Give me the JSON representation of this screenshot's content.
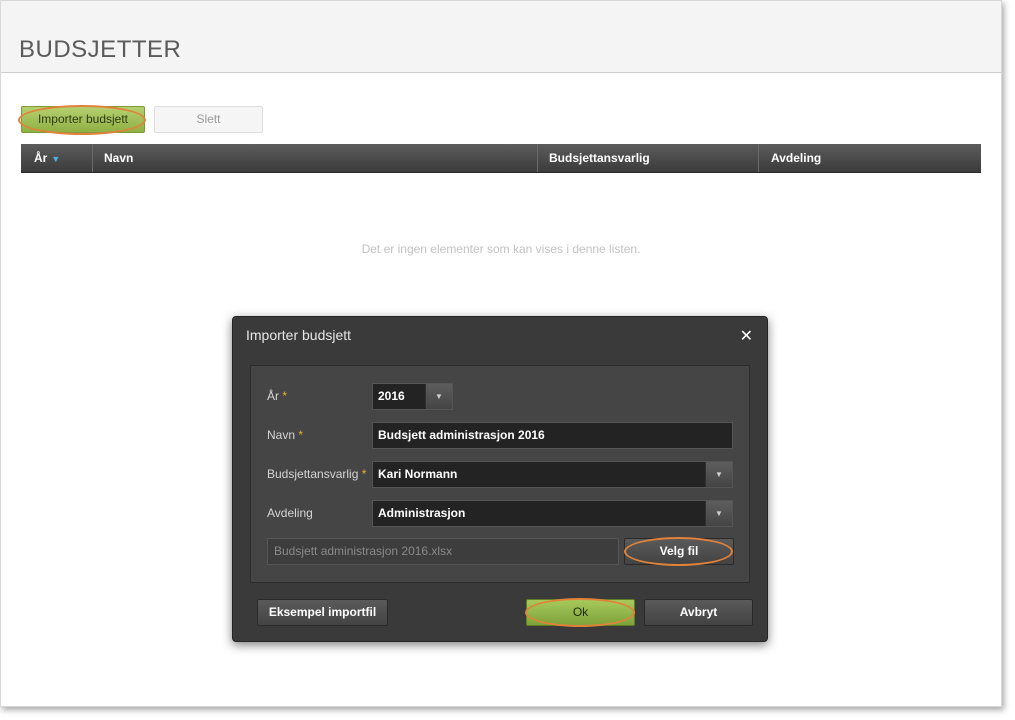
{
  "page": {
    "title": "BUDSJETTER"
  },
  "toolbar": {
    "import_label": "Importer budsjett",
    "delete_label": "Slett"
  },
  "grid": {
    "columns": [
      "År",
      "Navn",
      "Budsjettansvarlig",
      "Avdeling"
    ],
    "empty_message": "Det er ingen elementer som kan vises i denne listen."
  },
  "dialog": {
    "title": "Importer budsjett",
    "close_glyph": "✕",
    "fields": {
      "year": {
        "label": "År",
        "value": "2016"
      },
      "name": {
        "label": "Navn",
        "value": "Budsjett administrasjon 2016"
      },
      "owner": {
        "label": "Budsjettansvarlig",
        "value": "Kari Normann"
      },
      "department": {
        "label": "Avdeling",
        "value": "Administrasjon"
      }
    },
    "file": {
      "value": "Budsjett administrasjon 2016.xlsx",
      "choose_label": "Velg fil"
    },
    "buttons": {
      "example": "Eksempel importfil",
      "ok": "Ok",
      "cancel": "Avbryt"
    }
  },
  "icons": {
    "sort": "sort-desc-icon",
    "dropdown": "chevron-down-icon",
    "close": "close-icon"
  },
  "colors": {
    "accent_green": "#8fb044",
    "highlight_ring": "#e0823a",
    "required_star": "#f0b030",
    "sort_arrow": "#4fb3e8"
  }
}
